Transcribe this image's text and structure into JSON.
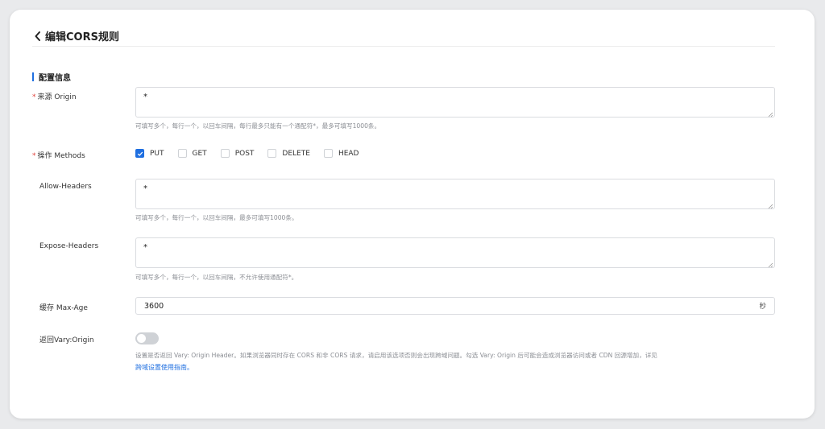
{
  "header": {
    "title": "编辑CORS规则"
  },
  "section": {
    "title": "配置信息"
  },
  "origin": {
    "required_mark": "*",
    "label": "来源 Origin",
    "value": "*",
    "hint": "可填写多个，每行一个，以回车间隔，每行最多只能有一个通配符*，最多可填写1000条。"
  },
  "methods": {
    "required_mark": "*",
    "label": "操作 Methods",
    "options": [
      {
        "label": "PUT",
        "checked": true
      },
      {
        "label": "GET",
        "checked": false
      },
      {
        "label": "POST",
        "checked": false
      },
      {
        "label": "DELETE",
        "checked": false
      },
      {
        "label": "HEAD",
        "checked": false
      }
    ]
  },
  "allow_headers": {
    "label": "Allow-Headers",
    "value": "*",
    "hint": "可填写多个，每行一个，以回车间隔，最多可填写1000条。"
  },
  "expose_headers": {
    "label": "Expose-Headers",
    "value": "*",
    "hint": "可填写多个，每行一个，以回车间隔，不允许使用通配符*。"
  },
  "max_age": {
    "label": "缓存 Max-Age",
    "value": "3600",
    "unit": "秒"
  },
  "vary": {
    "label": "返回Vary:Origin",
    "enabled": false,
    "hint": "设置是否返回 Vary: Origin Header。如果浏览器同时存在 CORS 和非 CORS 请求，请启用该选项否则会出现跨域问题。勾选 Vary: Origin 后可能会造成浏览器访问或者 CDN 回源增加，详见",
    "link": "跨域设置使用指南。"
  },
  "colors": {
    "accent": "#1f6fe0",
    "required": "#e0413b",
    "hint": "#8a8d93"
  }
}
